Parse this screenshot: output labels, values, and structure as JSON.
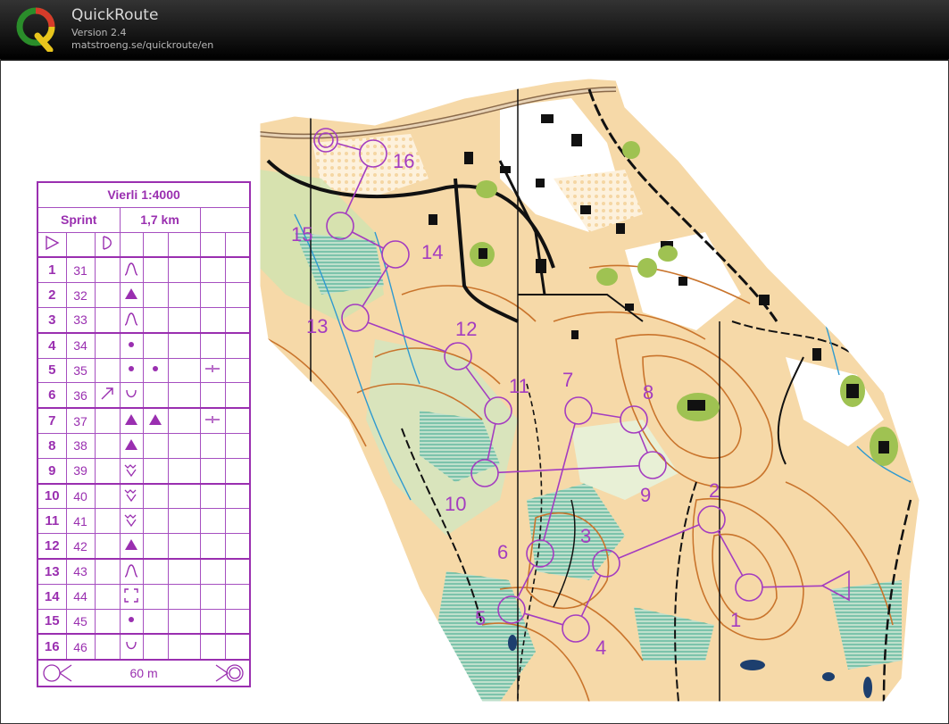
{
  "app": {
    "name": "QuickRoute",
    "version": "Version 2.4",
    "url": "matstroeng.se/quickroute/en",
    "logo_letter": "Q"
  },
  "colors": {
    "course": "#a43cc0",
    "header_bg": "#1a1a1a",
    "map_yellow": "#f5d6a3",
    "map_green": "#cfe8b8",
    "contour": "#c9742c",
    "building": "#111111"
  },
  "control_description": {
    "title": "Vierli 1:4000",
    "course_name": "Sprint",
    "length": "1,7 km",
    "start_symbol": "triangle-icon",
    "finish_distance": "60 m",
    "controls": [
      {
        "number": "1",
        "code": "31",
        "feature": "knoll-icon"
      },
      {
        "number": "2",
        "code": "32",
        "feature": "boulder-icon"
      },
      {
        "number": "3",
        "code": "33",
        "feature": "knoll-icon"
      },
      {
        "number": "4",
        "code": "34",
        "feature": "dot-icon"
      },
      {
        "number": "5",
        "code": "35",
        "feature": "dot-icon"
      },
      {
        "number": "6",
        "code": "36",
        "feature": "depression-icon"
      },
      {
        "number": "7",
        "code": "37",
        "feature": "boulder-icon"
      },
      {
        "number": "8",
        "code": "38",
        "feature": "boulder-icon"
      },
      {
        "number": "9",
        "code": "39",
        "feature": "marsh-icon"
      },
      {
        "number": "10",
        "code": "40",
        "feature": "marsh-icon"
      },
      {
        "number": "11",
        "code": "41",
        "feature": "marsh-icon"
      },
      {
        "number": "12",
        "code": "42",
        "feature": "boulder-icon"
      },
      {
        "number": "13",
        "code": "43",
        "feature": "knoll-icon"
      },
      {
        "number": "14",
        "code": "44",
        "feature": "ruin-icon"
      },
      {
        "number": "15",
        "code": "45",
        "feature": "dot-icon"
      },
      {
        "number": "16",
        "code": "46",
        "feature": "depression-icon"
      }
    ]
  },
  "course_map": {
    "control_labels": [
      "1",
      "2",
      "3",
      "4",
      "5",
      "6",
      "7",
      "8",
      "9",
      "10",
      "11",
      "12",
      "13",
      "14",
      "15",
      "16"
    ]
  }
}
